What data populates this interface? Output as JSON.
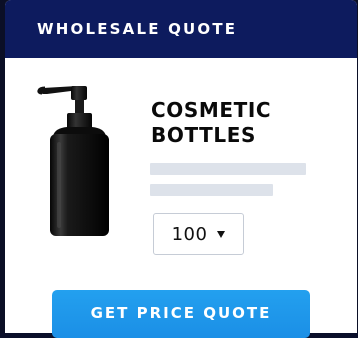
{
  "header": {
    "title": "WHOLESALE QUOTE"
  },
  "product": {
    "image_icon": "pump-bottle-icon",
    "name_line1": "COSMETIC",
    "name_line2": "BOTTLES"
  },
  "quantity": {
    "selected": "100",
    "icon": "caret-down-icon"
  },
  "cta": {
    "label": "GET PRICE QUOTE"
  },
  "colors": {
    "header_bg": "#0d1b5e",
    "page_bg": "#0b0f26",
    "accent": "#1b8fe6",
    "placeholder": "#dde2ea"
  }
}
